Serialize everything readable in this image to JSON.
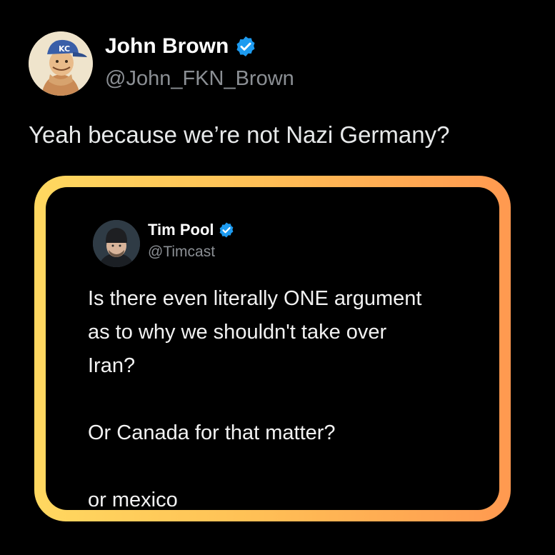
{
  "post": {
    "author": {
      "name": "John Brown",
      "handle": "@John_FKN_Brown",
      "verified": true,
      "avatar_icon": "cartoon-baseball-player-avatar"
    },
    "text": "Yeah because we’re not Nazi Germany?"
  },
  "quoted_post": {
    "author": {
      "name": "Tim Pool",
      "handle": "@Timcast",
      "verified": true,
      "avatar_icon": "man-in-beanie-avatar"
    },
    "lines": [
      "Is there even literally ONE argument",
      "as to why we shouldn't take over",
      "Iran?",
      "Or Canada for that matter?",
      "or mexico"
    ]
  },
  "colors": {
    "background": "#000000",
    "verified_badge": "#1d9bf0",
    "frame_gradient_start": "#ffd860",
    "frame_gradient_end": "#ff9950"
  }
}
